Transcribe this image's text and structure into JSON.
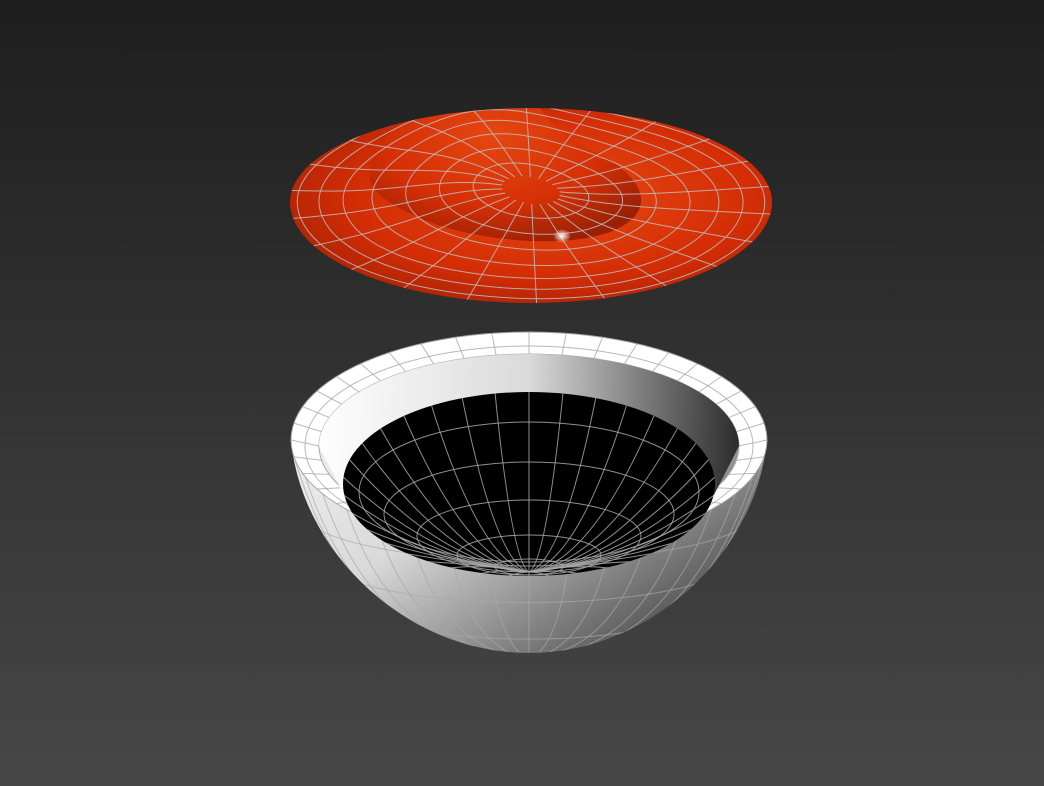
{
  "viewport": {
    "background_top": "#1e1e1e",
    "background_bottom": "#474747",
    "shading_mode": "smooth-highlights-edged-faces"
  },
  "objects": [
    {
      "id": "dome-lid",
      "kind": "deformed-disc",
      "color": "#d42d05",
      "color_light": "#e84a12",
      "color_dark": "#8e1c04",
      "wire_color": "#bdbdbd",
      "selected": false
    },
    {
      "id": "bowl",
      "kind": "hemisphere-bowl",
      "color": "#d9d9d9",
      "color_light": "#ffffff",
      "color_dark": "#262626",
      "interior_color": "#000000",
      "wire_color": "#a8a8a8",
      "selected": false
    }
  ]
}
